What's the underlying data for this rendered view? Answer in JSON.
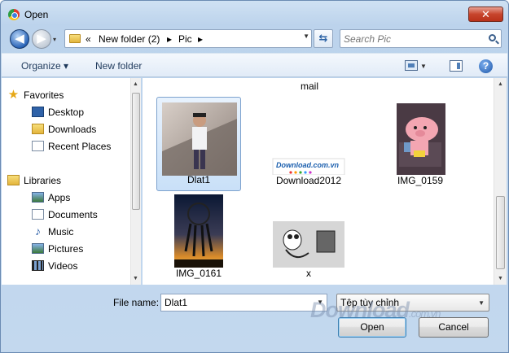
{
  "window": {
    "title": "Open",
    "close_symbol": "✕"
  },
  "nav": {
    "back_symbol": "◀",
    "forward_symbol": "▶",
    "history_arrow": "▾",
    "breadcrumb_overflow": "«",
    "breadcrumbs": [
      "New folder (2)",
      "Pic"
    ],
    "separator": "▸",
    "refresh_symbol": "⇆",
    "search_placeholder": "Search Pic"
  },
  "toolbar": {
    "organize_label": "Organize ▾",
    "new_folder_label": "New folder"
  },
  "sidebar": {
    "favorites_header": "Favorites",
    "favorites": [
      "Desktop",
      "Downloads",
      "Recent Places"
    ],
    "libraries_header": "Libraries",
    "libraries": [
      "Apps",
      "Documents",
      "Music",
      "Pictures",
      "Videos"
    ]
  },
  "files": {
    "partial_label": "mail",
    "items": [
      {
        "name": "Dlat1",
        "selected": true
      },
      {
        "name": "Download2012",
        "selected": false
      },
      {
        "name": "IMG_0159",
        "selected": false
      },
      {
        "name": "IMG_0161",
        "selected": false
      },
      {
        "name": "x",
        "selected": false
      }
    ],
    "download_logo_text": "Download.com.vn"
  },
  "bottom": {
    "file_name_label": "File name:",
    "file_name_value": "Dlat1",
    "file_type_value": "Tệp tùy chỉnh",
    "open_label": "Open",
    "cancel_label": "Cancel"
  },
  "watermark": {
    "text": "Download",
    "domain": ".com.vn"
  },
  "colors": {
    "accent": "#2b65b8",
    "selection": "#c9e0f8",
    "close": "#c7442c"
  }
}
